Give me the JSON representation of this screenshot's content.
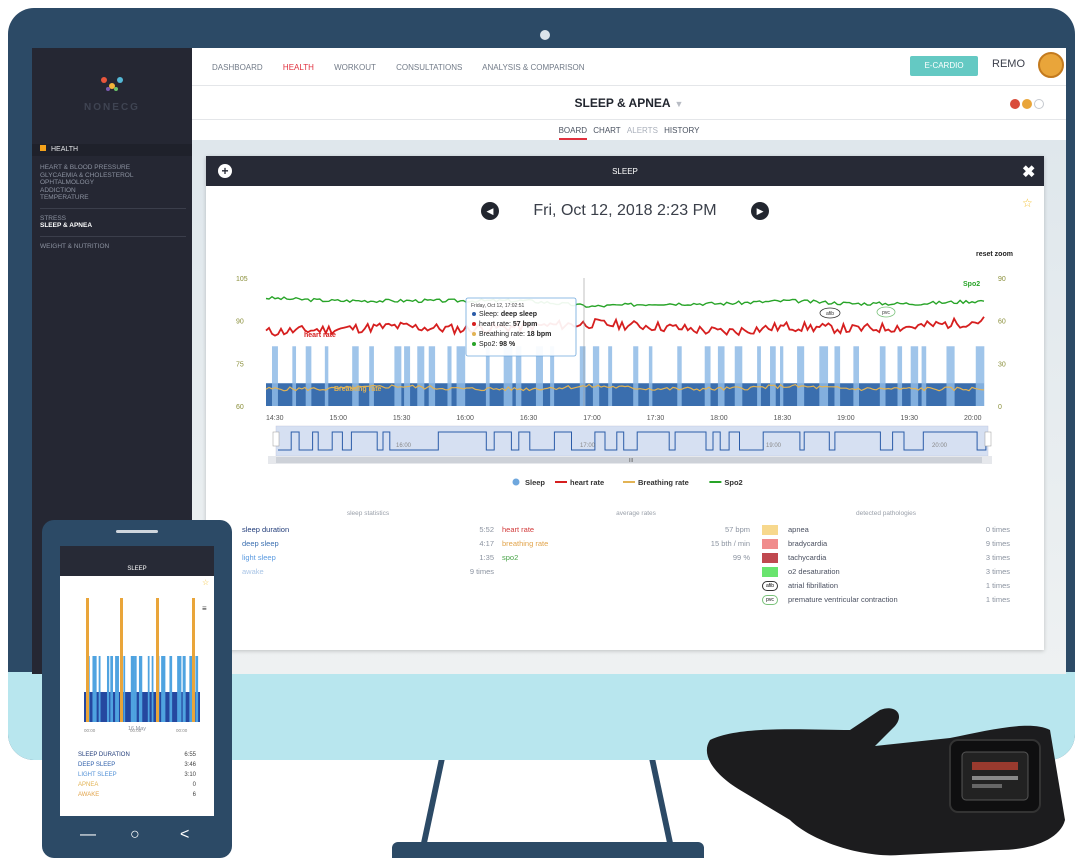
{
  "brand": {
    "name": "NONECG"
  },
  "sidebar": {
    "section": "HEALTH",
    "items": [
      {
        "label": "HEART & BLOOD PRESSURE",
        "active": false
      },
      {
        "label": "GLYCAEMIA & CHOLESTEROL",
        "active": false
      },
      {
        "label": "OPHTALMOLOGY",
        "active": false
      },
      {
        "label": "ADDICTION",
        "active": false
      },
      {
        "label": "TEMPERATURE",
        "active": false
      },
      {
        "label": "STRESS",
        "active": false
      },
      {
        "label": "SLEEP & APNEA",
        "active": true
      },
      {
        "label": "WEIGHT & NUTRITION",
        "active": false
      }
    ]
  },
  "nav": {
    "items": [
      "DASHBOARD",
      "HEALTH",
      "WORKOUT",
      "CONSULTATIONS",
      "ANALYSIS & COMPARISON"
    ],
    "selected": "HEALTH",
    "ecardio": "E-CARDIO",
    "user": "REMO"
  },
  "page": {
    "title": "SLEEP & APNEA"
  },
  "tabs": {
    "board": "BOARD",
    "chart": "CHART",
    "alerts": "ALERTS",
    "history": "HISTORY"
  },
  "panel": {
    "title": "SLEEP",
    "date": "Fri, Oct 12, 2018 2:23 PM",
    "reset_zoom": "reset zoom"
  },
  "tooltip": {
    "header": "Friday, Oct 12, 17:02:51",
    "sleep_label": "Sleep:",
    "sleep_value": "deep sleep",
    "hr_label": "heart rate:",
    "hr_value": "57 bpm",
    "br_label": "Breathing rate:",
    "br_value": "18 bpm",
    "spo2_label": "Spo2:",
    "spo2_value": "98 %"
  },
  "chart_data": {
    "type": "line",
    "x": [
      "14:30",
      "15:00",
      "15:30",
      "16:00",
      "16:30",
      "17:00",
      "17:30",
      "18:00",
      "18:30",
      "19:00",
      "19:30",
      "20:00"
    ],
    "navigator_labels": [
      "16:00",
      "17:00",
      "19:00",
      "20:00"
    ],
    "navigator_scroll_label": "III",
    "y_left": {
      "ticks": [
        105,
        90,
        75,
        60
      ],
      "ylim": [
        60,
        105
      ]
    },
    "y_right": {
      "ticks": [
        90,
        60,
        30,
        0
      ],
      "ylim": [
        0,
        90
      ]
    },
    "series": [
      {
        "name": "Sleep",
        "color": "#6ea7dd"
      },
      {
        "name": "heart rate",
        "color": "#d61f1f",
        "label": "heart rate",
        "values": [
          86,
          87,
          88,
          87,
          88,
          89,
          88,
          86,
          88,
          87,
          88,
          90
        ]
      },
      {
        "name": "Breathing rate",
        "color": "#e2b354",
        "label": "Breathing rate",
        "values": [
          66,
          66,
          67,
          66,
          66,
          67,
          66,
          66,
          67,
          66,
          66,
          66
        ]
      },
      {
        "name": "Spo2",
        "color": "#28a428",
        "label": "Spo2",
        "values": [
          98,
          97,
          97,
          97,
          97,
          95,
          96,
          96,
          97,
          96,
          96,
          97
        ]
      }
    ],
    "annotations": [
      "afib",
      "pvc"
    ]
  },
  "stats": {
    "sleep": {
      "title": "sleep statistics",
      "rows": [
        {
          "label": "sleep duration",
          "value": "5:52"
        },
        {
          "label": "deep sleep",
          "value": "4:17"
        },
        {
          "label": "light sleep",
          "value": "1:35"
        },
        {
          "label": "awake",
          "value": "9 times"
        }
      ]
    },
    "rates": {
      "title": "average rates",
      "rows": [
        {
          "label": "heart rate",
          "value": "57 bpm"
        },
        {
          "label": "breathing rate",
          "value": "15 bth / min"
        },
        {
          "label": "spo2",
          "value": "99 %"
        }
      ]
    },
    "pathologies": {
      "title": "detected pathologies",
      "rows": [
        {
          "label": "apnea",
          "value": "0 times",
          "color": "#f7d88d"
        },
        {
          "label": "bradycardia",
          "value": "9 times",
          "color": "#f08c8c"
        },
        {
          "label": "tachycardia",
          "value": "3 times",
          "color": "#c0484f"
        },
        {
          "label": "o2 desaturation",
          "value": "3 times",
          "color": "#69e46e"
        },
        {
          "label": "atrial fibrillation",
          "value": "1 times",
          "badge": "afib"
        },
        {
          "label": "premature ventricular contraction",
          "value": "1 times",
          "badge": "pvc"
        }
      ]
    }
  },
  "phone": {
    "title": "SLEEP",
    "axis": [
      "00:00",
      "00:00",
      "00:00"
    ],
    "date": "16 May",
    "rows": [
      {
        "label": "SLEEP DURATION",
        "value": "6:55",
        "color": "#223d7a"
      },
      {
        "label": "DEEP SLEEP",
        "value": "3:46",
        "color": "#2b5ca8"
      },
      {
        "label": "LIGHT SLEEP",
        "value": "3:10",
        "color": "#4f8fd6"
      },
      {
        "label": "APNEA",
        "value": "0",
        "color": "#e2b354"
      },
      {
        "label": "AWAKE",
        "value": "6",
        "color": "#e2a44b"
      }
    ]
  }
}
